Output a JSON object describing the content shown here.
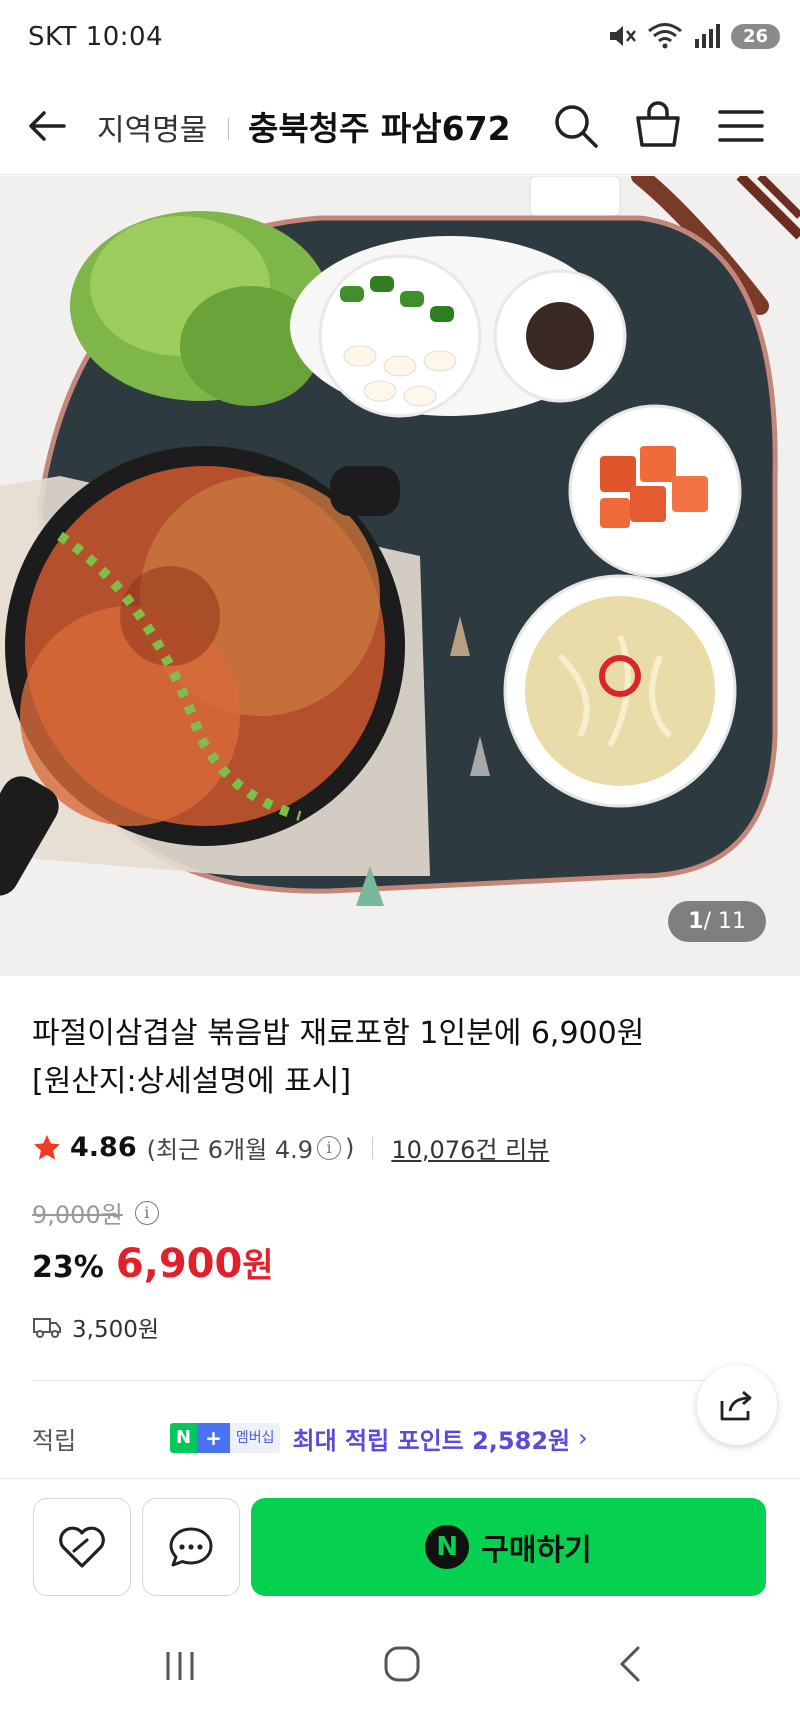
{
  "status_bar": {
    "carrier": "SKT",
    "time": "10:04",
    "battery": "26"
  },
  "header": {
    "category": "지역명물",
    "store_name": "충북청주 파삼672",
    "icons": [
      "back-arrow-icon",
      "search-icon",
      "cart-icon",
      "menu-icon"
    ]
  },
  "gallery": {
    "current": "1",
    "total": "/ 11"
  },
  "product": {
    "title_line1": "파절이삼겹살 볶음밥 재료포함 1인분에 6,900원",
    "title_line2": "[원산지:상세설명에 표시]",
    "rating": "4.86",
    "recent_rating": "(최근 6개월 4.9",
    "recent_close": ")",
    "review_count": "10,076건 리뷰",
    "original_price": "9,000원",
    "discount": "23%",
    "sale_price": "6,900",
    "sale_unit": "원",
    "shipping": "3,500원"
  },
  "points": {
    "label": "적립",
    "badge_n": "N",
    "badge_plus": "+",
    "badge_member": "멤버십",
    "text": "최대 적립 포인트 2,582원",
    "chevron": "›"
  },
  "actions": {
    "buy_label": "구매하기",
    "buy_logo": "N"
  },
  "colors": {
    "accent_green": "#05d050",
    "price_red": "#e1202a",
    "points_purple": "#5a4ad8"
  }
}
